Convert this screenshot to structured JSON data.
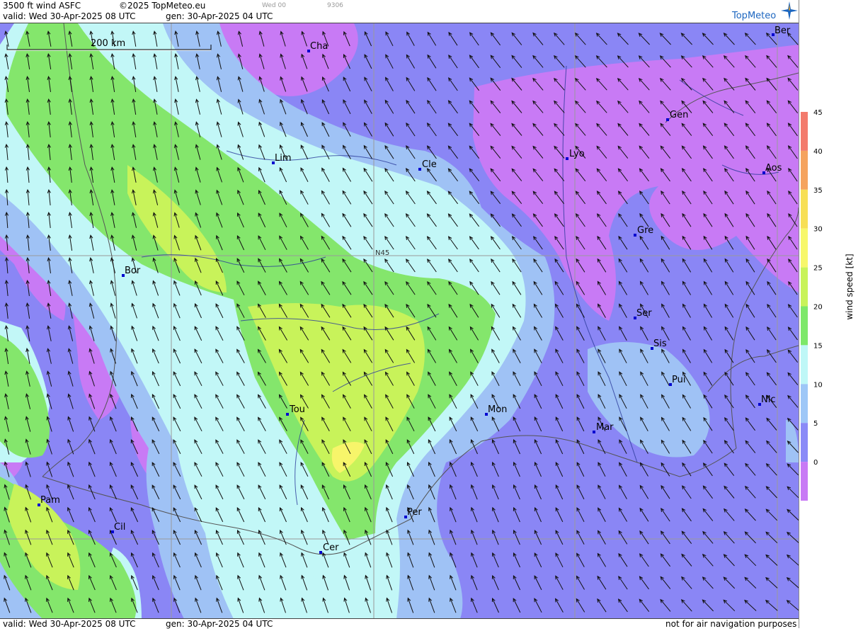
{
  "header": {
    "title": "3500 ft wind ASFC",
    "copyright": "©2025 TopMeteo.eu",
    "valid": "valid:  Wed  30-Apr-2025  08 UTC",
    "generated": "gen:  30-Apr-2025 04 UTC",
    "run": "Wed 00",
    "code": "9306"
  },
  "brand": "TopMeteo",
  "scale_bar": "200 km",
  "latitude_label": "N45",
  "cities": [
    "Ber",
    "Cha",
    "Gen",
    "Lim",
    "Cle",
    "Lyo",
    "Aos",
    "Gre",
    "Bor",
    "Ser",
    "Sis",
    "Pui",
    "Tou",
    "Mon",
    "Nic",
    "Mar",
    "Pam",
    "Cil",
    "Per",
    "Cer"
  ],
  "footer": {
    "valid": "valid:  Wed  30-Apr-2025  08 UTC",
    "generated": "gen:  30-Apr-2025 04 UTC",
    "disclaimer": "not for air navigation purposes"
  },
  "legend": {
    "title": "wind speed [kt]",
    "ticks": [
      "45",
      "40",
      "35",
      "30",
      "25",
      "20",
      "15",
      "10",
      "5",
      "0"
    ],
    "colors": [
      "#f37a6c",
      "#f5a35e",
      "#f7df55",
      "#f7f76a",
      "#c8f35a",
      "#7de86a",
      "#bff7f7",
      "#9ec7f7",
      "#8a8af7",
      "#c87af5"
    ]
  },
  "colors": {
    "wind_0_5": "#c87af5",
    "wind_5_10": "#8a86f5",
    "wind_10_15": "#9fc2f5",
    "wind_15_20": "#c2f7f7",
    "wind_20_25": "#84e66c",
    "wind_25_30": "#c8f35a",
    "wind_30_35": "#f7f56a"
  }
}
